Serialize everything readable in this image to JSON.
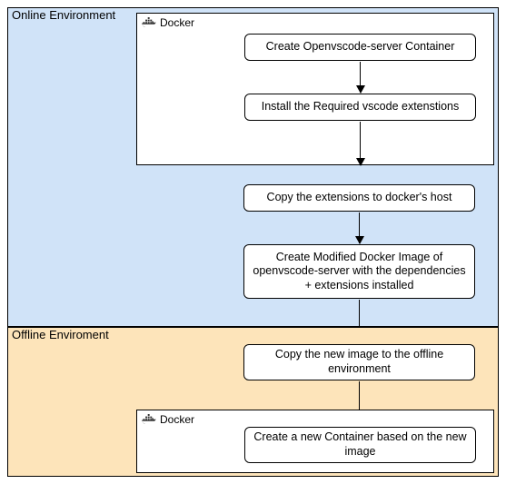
{
  "env": {
    "online_label": "Online Environment",
    "offline_label": "Offline Enviroment"
  },
  "docker_label": "Docker",
  "steps": {
    "s1": "Create Openvscode-server Container",
    "s2": "Install the Required vscode extenstions",
    "s3": "Copy the extensions to docker's host",
    "s4": "Create Modified Docker Image of openvscode-server with the dependencies + extensions installed",
    "s5": "Copy the new image to the offline environment",
    "s6": "Create a new Container based on the new image"
  },
  "colors": {
    "online_bg": "#d0e3f8",
    "offline_bg": "#fde4ba"
  }
}
